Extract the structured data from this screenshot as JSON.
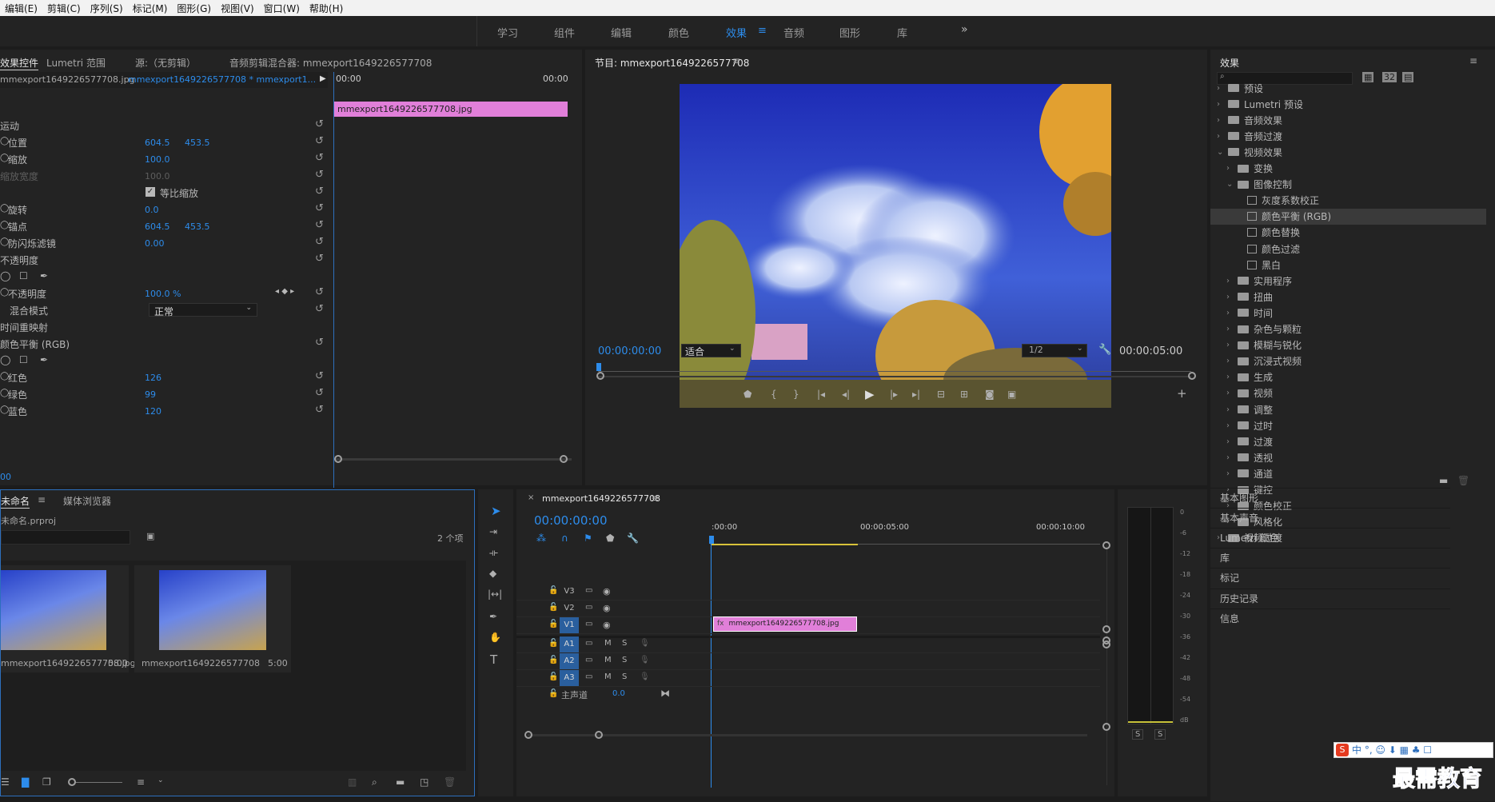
{
  "menu": [
    "编辑(E)",
    "剪辑(C)",
    "序列(S)",
    "标记(M)",
    "图形(G)",
    "视图(V)",
    "窗口(W)",
    "帮助(H)"
  ],
  "workspaces": [
    "学习",
    "组件",
    "编辑",
    "颜色",
    "效果",
    "音频",
    "图形",
    "库"
  ],
  "workspace_active": "效果",
  "effect_controls": {
    "tabs": [
      "效果控件",
      "Lumetri 范围",
      "源:（无剪辑）",
      "音频剪辑混合器: mmexport1649226577708"
    ],
    "source_clip": "mmexport1649226577708.jpg",
    "sequence_clip": "mmexport1649226577708 * mmexport1...",
    "mini_time_start": "00:00",
    "mini_time_end": "00:00",
    "mini_clip": "mmexport1649226577708.jpg",
    "motion": "运动",
    "position_label": "位置",
    "position_x": "604.5",
    "position_y": "453.5",
    "scale_label": "缩放",
    "scale_value": "100.0",
    "scale_width_label": "缩放宽度",
    "scale_width_value": "100.0",
    "uniform_label": "等比缩放",
    "rotation_label": "旋转",
    "rotation_value": "0.0",
    "anchor_label": "锚点",
    "anchor_x": "604.5",
    "anchor_y": "453.5",
    "flicker_label": "防闪烁滤镜",
    "flicker_value": "0.00",
    "opacity_section": "不透明度",
    "opacity_label": "不透明度",
    "opacity_value": "100.0 %",
    "blend_label": "混合模式",
    "blend_value": "正常",
    "time_remap": "时间重映射",
    "color_balance": "颜色平衡 (RGB)",
    "red_label": "红色",
    "red_value": "126",
    "green_label": "绿色",
    "green_value": "99",
    "blue_label": "蓝色",
    "blue_value": "120",
    "bottom_time": "00"
  },
  "program": {
    "title": "节目: mmexport1649226577708",
    "timecode": "00:00:00:00",
    "fit": "适合",
    "resolution": "1/2",
    "duration": "00:00:05:00"
  },
  "effects": {
    "title": "效果",
    "tree": [
      {
        "label": "预设",
        "level": 0,
        "open": false,
        "kind": "folder"
      },
      {
        "label": "Lumetri 预设",
        "level": 0,
        "open": false,
        "kind": "folder"
      },
      {
        "label": "音频效果",
        "level": 0,
        "open": false,
        "kind": "folder"
      },
      {
        "label": "音频过渡",
        "level": 0,
        "open": false,
        "kind": "folder"
      },
      {
        "label": "视频效果",
        "level": 0,
        "open": true,
        "kind": "folder"
      },
      {
        "label": "变换",
        "level": 1,
        "open": false,
        "kind": "folder"
      },
      {
        "label": "图像控制",
        "level": 1,
        "open": true,
        "kind": "folder"
      },
      {
        "label": "灰度系数校正",
        "level": 2,
        "kind": "preset"
      },
      {
        "label": "颜色平衡 (RGB)",
        "level": 2,
        "kind": "preset",
        "selected": true
      },
      {
        "label": "颜色替换",
        "level": 2,
        "kind": "preset"
      },
      {
        "label": "颜色过滤",
        "level": 2,
        "kind": "preset"
      },
      {
        "label": "黑白",
        "level": 2,
        "kind": "preset"
      },
      {
        "label": "实用程序",
        "level": 1,
        "open": false,
        "kind": "folder"
      },
      {
        "label": "扭曲",
        "level": 1,
        "open": false,
        "kind": "folder"
      },
      {
        "label": "时间",
        "level": 1,
        "open": false,
        "kind": "folder"
      },
      {
        "label": "杂色与颗粒",
        "level": 1,
        "open": false,
        "kind": "folder"
      },
      {
        "label": "模糊与锐化",
        "level": 1,
        "open": false,
        "kind": "folder"
      },
      {
        "label": "沉浸式视频",
        "level": 1,
        "open": false,
        "kind": "folder"
      },
      {
        "label": "生成",
        "level": 1,
        "open": false,
        "kind": "folder"
      },
      {
        "label": "视频",
        "level": 1,
        "open": false,
        "kind": "folder"
      },
      {
        "label": "调整",
        "level": 1,
        "open": false,
        "kind": "folder"
      },
      {
        "label": "过时",
        "level": 1,
        "open": false,
        "kind": "folder"
      },
      {
        "label": "过渡",
        "level": 1,
        "open": false,
        "kind": "folder"
      },
      {
        "label": "透视",
        "level": 1,
        "open": false,
        "kind": "folder"
      },
      {
        "label": "通道",
        "level": 1,
        "open": false,
        "kind": "folder"
      },
      {
        "label": "键控",
        "level": 1,
        "open": false,
        "kind": "folder"
      },
      {
        "label": "颜色校正",
        "level": 1,
        "open": false,
        "kind": "folder"
      },
      {
        "label": "风格化",
        "level": 1,
        "open": false,
        "kind": "folder"
      },
      {
        "label": "视频过渡",
        "level": 0,
        "open": false,
        "kind": "folder"
      }
    ],
    "side_panels": [
      "基本图形",
      "基本声音",
      "Lumetri 颜色",
      "库",
      "标记",
      "历史记录",
      "信息"
    ]
  },
  "project": {
    "tabs": [
      "未命名",
      "媒体浏览器"
    ],
    "file": "未命名.prproj",
    "count": "2 个项",
    "items": [
      {
        "name": "mmexport1649226577708.jpg",
        "dur": "5:00"
      },
      {
        "name": "mmexport1649226577708",
        "dur": "5:00"
      }
    ]
  },
  "timeline": {
    "title": "mmexport1649226577708",
    "timecode": "00:00:00:00",
    "ruler": [
      ":00:00",
      "00:00:05:00",
      "00:00:10:00"
    ],
    "tracks_v": [
      "V3",
      "V2",
      "V1"
    ],
    "tracks_a": [
      "A1",
      "A2",
      "A3"
    ],
    "master_label": "主声道",
    "master_value": "0.0",
    "clip": "mmexport1649226577708.jpg"
  },
  "meter": {
    "labels": [
      "0",
      "-6",
      "-12",
      "-18",
      "-24",
      "-30",
      "-36",
      "-42",
      "-48",
      "-54",
      "dB"
    ],
    "solo": [
      "S",
      "S"
    ]
  },
  "watermark": "最需教育",
  "ime": "中 °, ☺ ⬇ ▦ ♣ ☐",
  "colors": {
    "accent": "#2d8ceb",
    "clip": "#e17fd9",
    "panel": "#232323"
  }
}
